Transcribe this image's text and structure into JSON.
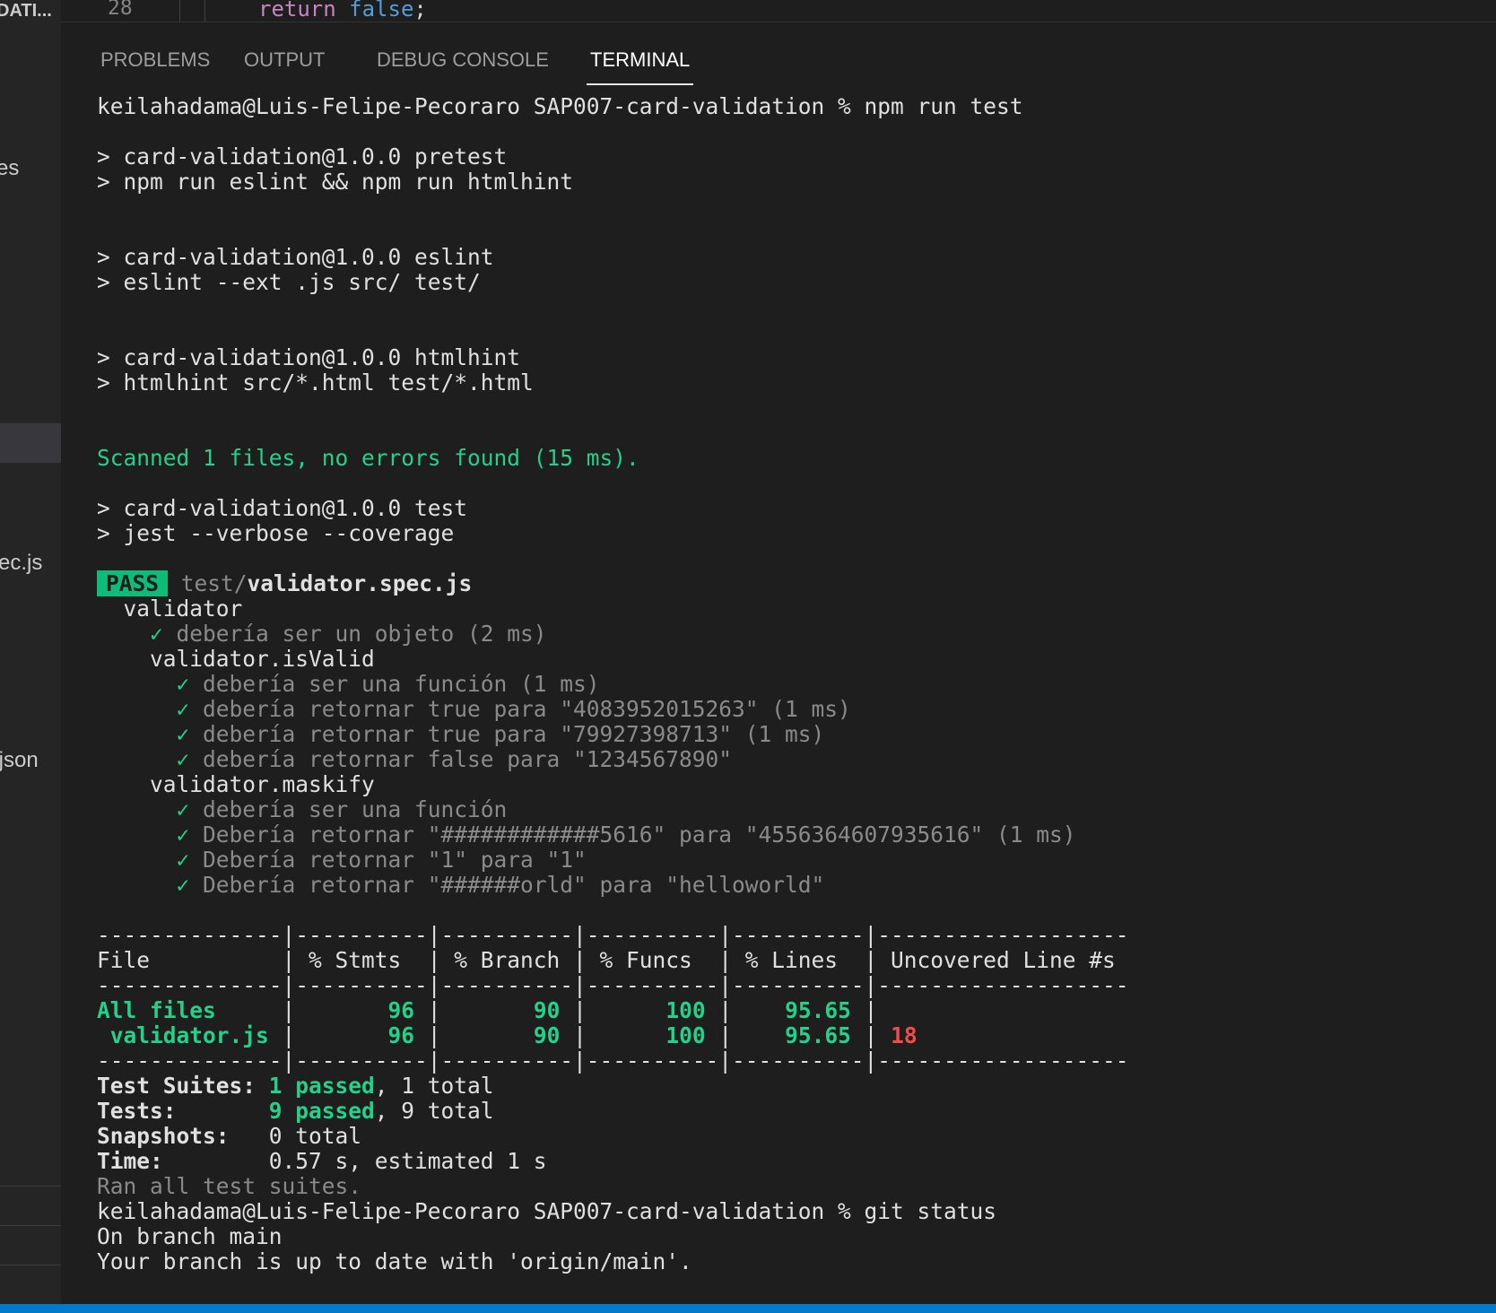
{
  "sidebar": {
    "header": "DATI...",
    "items": [
      {
        "label": "es"
      },
      {
        "label": "ec.js"
      },
      {
        "label": ".json"
      }
    ]
  },
  "editor": {
    "line_number": "28",
    "code_return": "return",
    "code_false": "false",
    "code_end": ";"
  },
  "tabs": [
    {
      "label": "PROBLEMS"
    },
    {
      "label": "OUTPUT"
    },
    {
      "label": "DEBUG CONSOLE"
    },
    {
      "label": "TERMINAL",
      "active": true
    }
  ],
  "terminal": {
    "prompt1": "keilahadama@Luis-Felipe-Pecoraro SAP007-card-validation % npm run test",
    "pretest1": "> card-validation@1.0.0 pretest",
    "pretest2": "> npm run eslint && npm run htmlhint",
    "eslint1": "> card-validation@1.0.0 eslint",
    "eslint2": "> eslint --ext .js src/ test/",
    "htmlhint1": "> card-validation@1.0.0 htmlhint",
    "htmlhint2": "> htmlhint src/*.html test/*.html",
    "scanned": "Scanned 1 files, no errors found (15 ms).",
    "test1": "> card-validation@1.0.0 test",
    "test2": "> jest --verbose --coverage",
    "pass_badge": "PASS",
    "pass_dir": "test/",
    "pass_file": "validator.spec.js",
    "suite_validator": "  validator",
    "t1_check": "    ✓ ",
    "t1": "debería ser un objeto (2 ms)",
    "suite_isvalid": "    validator.isValid",
    "t2_check": "      ✓ ",
    "t2": "debería ser una función (1 ms)",
    "t3_check": "      ✓ ",
    "t3": "debería retornar true para \"4083952015263\" (1 ms)",
    "t4_check": "      ✓ ",
    "t4": "debería retornar true para \"79927398713\" (1 ms)",
    "t5_check": "      ✓ ",
    "t5": "debería retornar false para \"1234567890\"",
    "suite_maskify": "    validator.maskify",
    "t6_check": "      ✓ ",
    "t6": "debería ser una función",
    "t7_check": "      ✓ ",
    "t7": "Debería retornar \"############5616\" para \"4556364607935616\" (1 ms)",
    "t8_check": "      ✓ ",
    "t8": "Debería retornar \"1\" para \"1\"",
    "t9_check": "      ✓ ",
    "t9": "Debería retornar \"######orld\" para \"helloworld\"",
    "cov_sep": "--------------|----------|----------|----------|----------|-------------------",
    "cov_header": "File          | % Stmts  | % Branch | % Funcs  | % Lines  | Uncovered Line #s ",
    "cov_all_name": "All files",
    "cov_all_pad": "     | ",
    "cov_all_stmts": "      96",
    "cov_all_branch": "      90",
    "cov_all_funcs": "     100",
    "cov_all_lines": "   95.65",
    "cov_file_name": " validator.js",
    "cov_file_pad": " | ",
    "cov_file_stmts": "      96",
    "cov_file_branch": "      90",
    "cov_file_funcs": "     100",
    "cov_file_lines": "   95.65",
    "cov_file_uncovered": "18",
    "sum_suites_label": "Test Suites: ",
    "sum_suites_pass": "1 passed",
    "sum_suites_total": ", 1 total",
    "sum_tests_label": "Tests:       ",
    "sum_tests_pass": "9 passed",
    "sum_tests_total": ", 9 total",
    "sum_snap_label": "Snapshots:   ",
    "sum_snap_val": "0 total",
    "sum_time_label": "Time:        ",
    "sum_time_val": "0.57 s, estimated 1 s",
    "ran_all": "Ran all test suites.",
    "prompt2": "keilahadama@Luis-Felipe-Pecoraro SAP007-card-validation % git status",
    "branch1": "On branch main",
    "branch2": "Your branch is up to date with 'origin/main'."
  },
  "colors": {
    "accent_green": "#23d18b",
    "pass_badge_bg": "#0dbc79",
    "error_red": "#f14c4c",
    "status_bar": "#007acc"
  }
}
